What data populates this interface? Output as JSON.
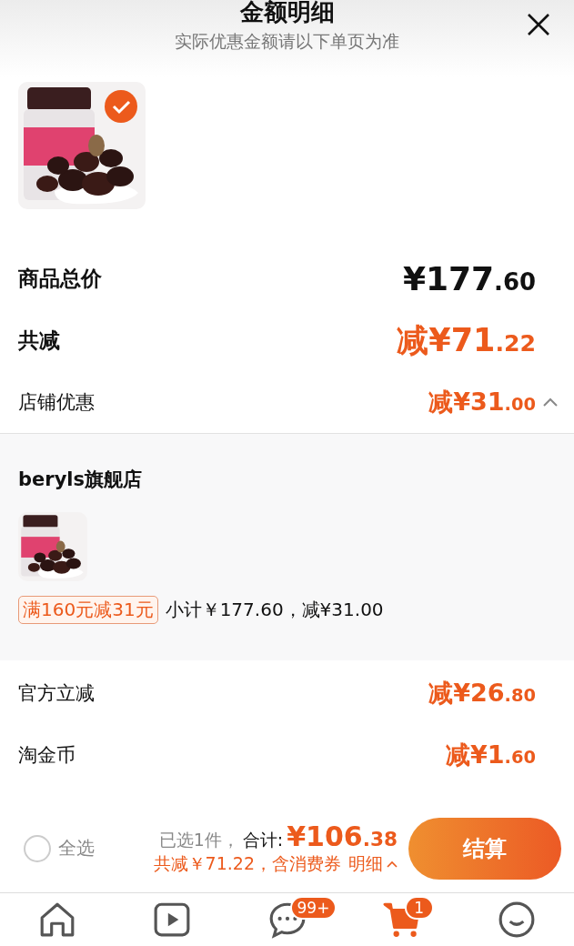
{
  "header": {
    "title": "金额明细",
    "subtitle": "实际优惠金额请以下单页为准"
  },
  "product": {
    "selected": true
  },
  "summary": [
    {
      "label": "商品总价",
      "main": "¥177",
      "cents": ".60",
      "kind": "total"
    },
    {
      "label": "共减",
      "main": "减¥71",
      "cents": ".22",
      "kind": "discount"
    },
    {
      "label": "店铺优惠",
      "main": "减¥31",
      "cents": ".00",
      "kind": "sub",
      "expanded": true
    }
  ],
  "store": {
    "name": "beryls旗舰店",
    "tag": "满160元减31元",
    "subtotal": "小计￥177.60，减¥31.00"
  },
  "extra": [
    {
      "label": "官方立减",
      "main": "减¥26",
      "cents": ".80"
    },
    {
      "label": "淘金币",
      "main": "减¥1",
      "cents": ".60"
    }
  ],
  "footer": {
    "select_all": {
      "label": "全选",
      "checked": false
    },
    "count": "已选1件，",
    "total_label": "合计:",
    "total_main": "¥106",
    "total_cents": ".38",
    "saved": "共减￥71.22，含消费券",
    "detail": "明细",
    "button": "结算"
  },
  "tabs": [
    {
      "kind": "home",
      "selected": false
    },
    {
      "kind": "video",
      "selected": false
    },
    {
      "kind": "message",
      "selected": false,
      "badge": "99+"
    },
    {
      "kind": "cart",
      "selected": true,
      "badge": "1"
    },
    {
      "kind": "profile",
      "selected": false
    }
  ]
}
